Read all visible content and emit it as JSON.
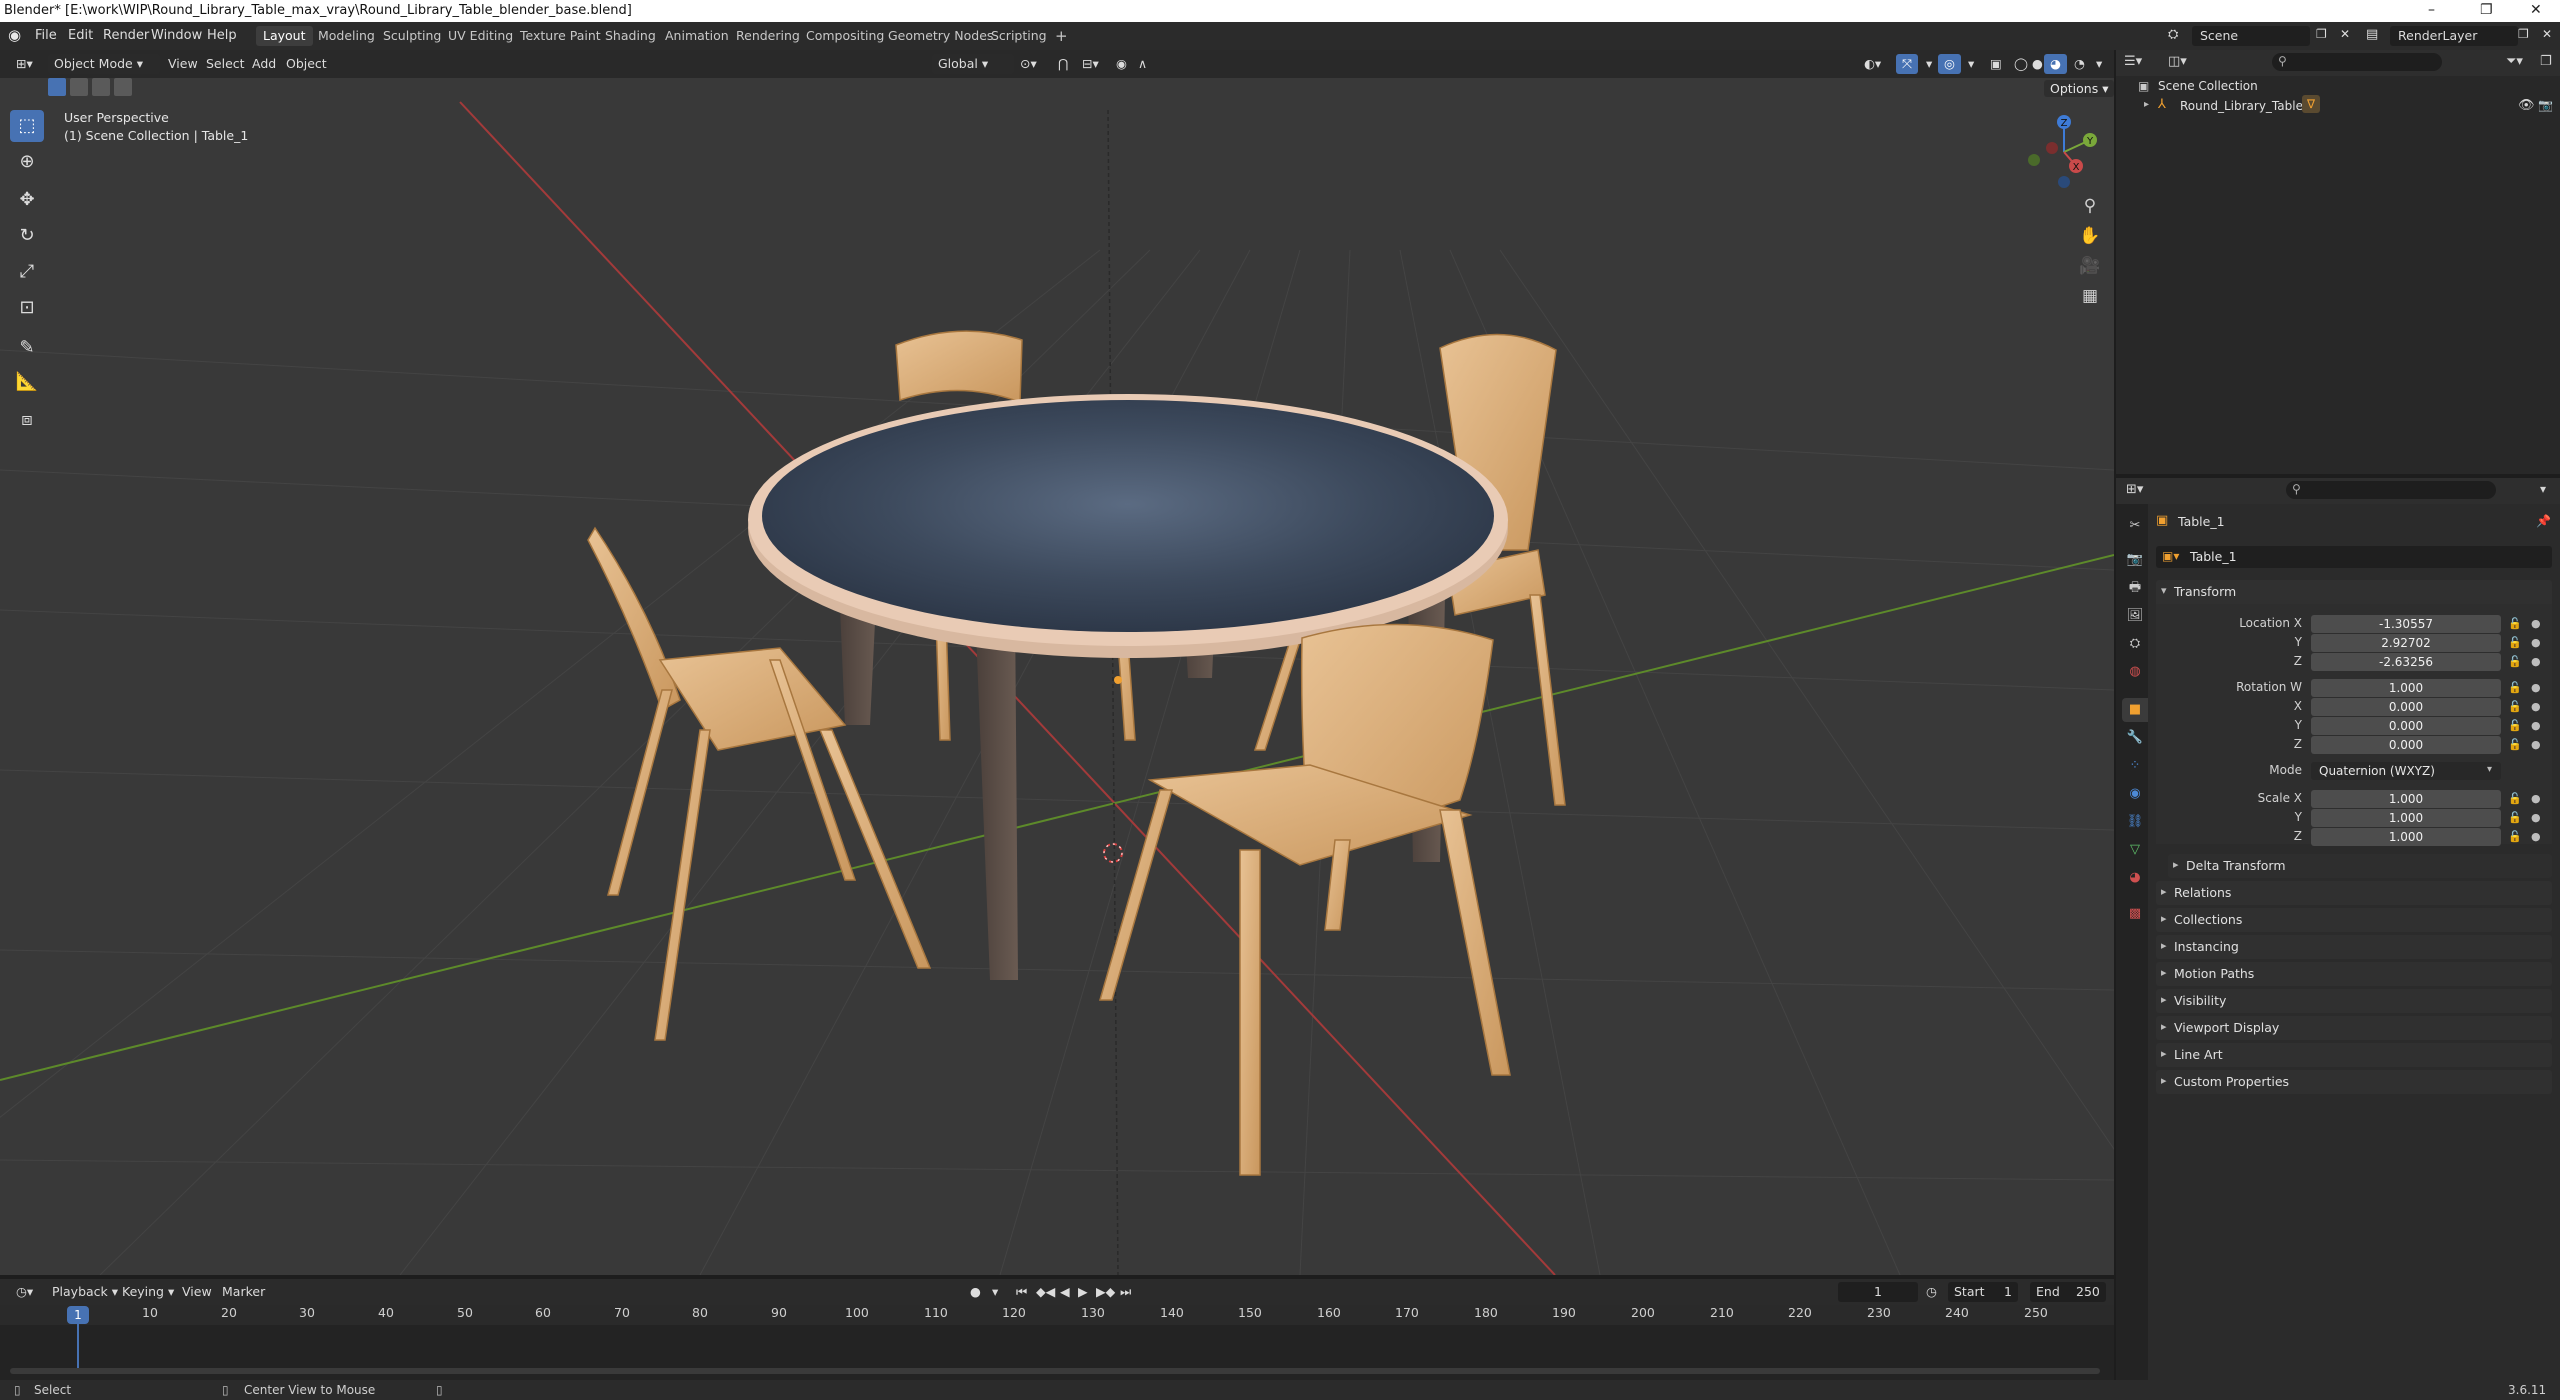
{
  "window": {
    "title": "Blender* [E:\\work\\WIP\\Round_Library_Table_max_vray\\Round_Library_Table_blender_base.blend]",
    "minimize": "–",
    "maximize": "❐",
    "close": "✕"
  },
  "menu": {
    "items": [
      "File",
      "Edit",
      "Render",
      "Window",
      "Help"
    ]
  },
  "workspaces": {
    "tabs": [
      "Layout",
      "Modeling",
      "Sculpting",
      "UV Editing",
      "Texture Paint",
      "Shading",
      "Animation",
      "Rendering",
      "Compositing",
      "Geometry Nodes",
      "Scripting"
    ],
    "add": "+"
  },
  "topright": {
    "scene": "Scene",
    "view_layer": "RenderLayer"
  },
  "viewport": {
    "mode": "Object Mode",
    "menus": [
      "View",
      "Select",
      "Add",
      "Object"
    ],
    "orientation": "Global",
    "options_label": "Options",
    "overlay_line1": "User Perspective",
    "overlay_line2": "(1) Scene Collection | Table_1",
    "gizmo": {
      "z": "Z",
      "y": "Y",
      "x": "X"
    }
  },
  "outliner": {
    "root": "Scene Collection",
    "items": [
      {
        "name": "Round_Library_Table"
      }
    ]
  },
  "properties": {
    "object_name": "Table_1",
    "data_name": "Table_1",
    "transform_title": "Transform",
    "location": {
      "label": "Location X",
      "x": "-1.30557",
      "y": "2.92702",
      "z": "-2.63256"
    },
    "rotation": {
      "label": "Rotation W",
      "w": "1.000",
      "x": "0.000",
      "y": "0.000",
      "z": "0.000"
    },
    "mode_label": "Mode",
    "mode_value": "Quaternion (WXYZ)",
    "scale": {
      "label": "Scale X",
      "x": "1.000",
      "y": "1.000",
      "z": "1.000"
    },
    "axis": {
      "x": "X",
      "y": "Y",
      "z": "Z"
    },
    "delta_transform": "Delta Transform",
    "panels": [
      "Relations",
      "Collections",
      "Instancing",
      "Motion Paths",
      "Visibility",
      "Viewport Display",
      "Line Art",
      "Custom Properties"
    ]
  },
  "timeline": {
    "menus": [
      "Playback",
      "Keying",
      "View",
      "Marker"
    ],
    "current_frame": "1",
    "start_label": "Start",
    "start": "1",
    "end_label": "End",
    "end": "250",
    "frame_labels": [
      "10",
      "20",
      "30",
      "40",
      "50",
      "60",
      "70",
      "80",
      "90",
      "100",
      "110",
      "120",
      "130",
      "140",
      "150",
      "160",
      "170",
      "180",
      "190",
      "200",
      "210",
      "220",
      "230",
      "240",
      "250"
    ],
    "playhead": "1"
  },
  "status": {
    "left": "Select",
    "middle": "Center View to Mouse",
    "version": "3.6.11"
  },
  "colors": {
    "accent": "#4772b3",
    "x_axis": "#c94a4a",
    "y_axis": "#7aa83a",
    "z_axis": "#3e7bd6"
  }
}
